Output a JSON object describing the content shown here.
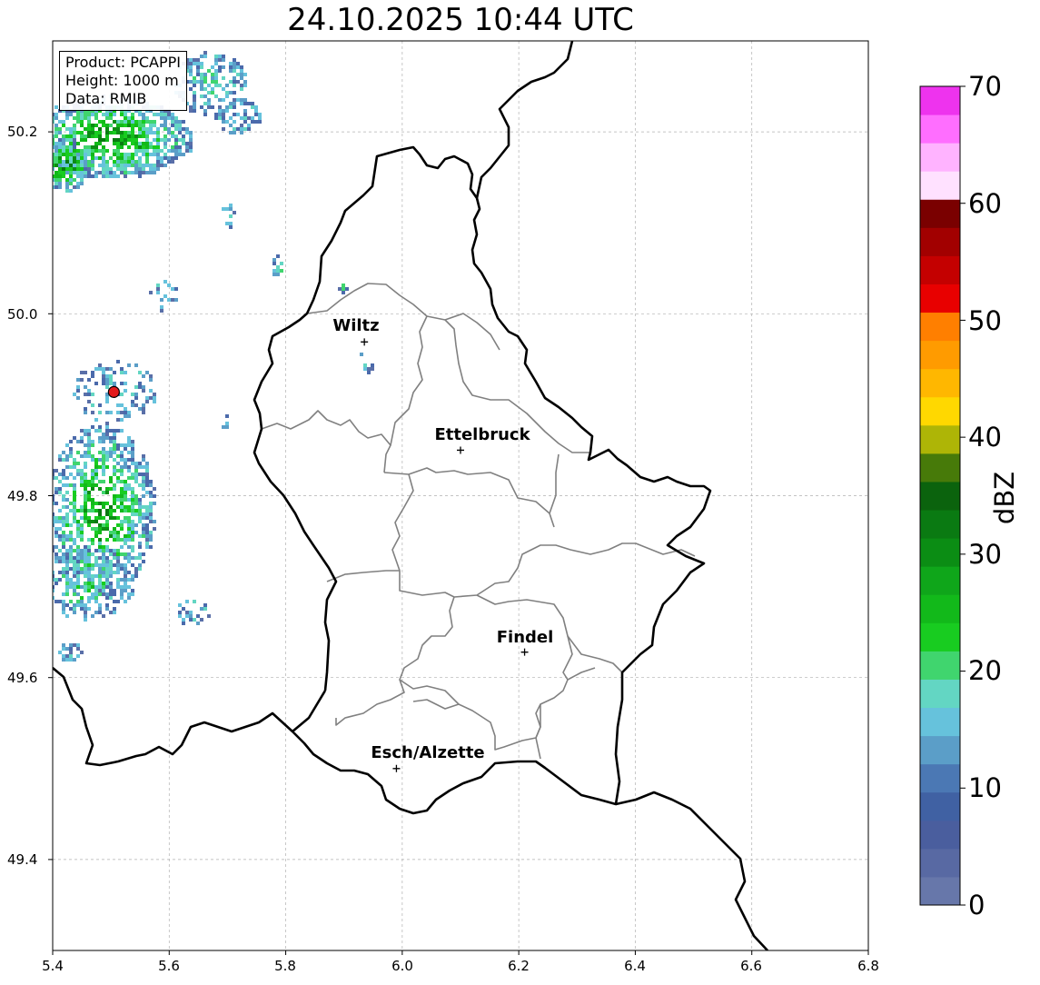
{
  "title": "24.10.2025 10:44 UTC",
  "info": {
    "product": "Product: PCAPPI",
    "height": "Height: 1000 m",
    "source": "Data: RMIB"
  },
  "axes": {
    "x_ticks": [
      "5.4",
      "5.6",
      "5.8",
      "6.0",
      "6.2",
      "6.4",
      "6.6",
      "6.8"
    ],
    "y_ticks": [
      "49.4",
      "49.6",
      "49.8",
      "50.0",
      "50.2"
    ],
    "lon_range": [
      5.4,
      6.8
    ],
    "lat_range": [
      49.3,
      50.3
    ]
  },
  "cities": [
    {
      "name": "Wiltz",
      "lon": 5.935,
      "lat": 49.969
    },
    {
      "name": "Ettelbruck",
      "lon": 6.1,
      "lat": 49.85
    },
    {
      "name": "Findel",
      "lon": 6.21,
      "lat": 49.628
    },
    {
      "name": "Esch/Alzette",
      "lon": 5.99,
      "lat": 49.5
    }
  ],
  "radar_site": {
    "lon": 5.505,
    "lat": 49.914,
    "color": "#e41a1c"
  },
  "colorbar": {
    "label": "dBZ",
    "ticks": [
      "0",
      "10",
      "20",
      "30",
      "40",
      "50",
      "60",
      "70"
    ],
    "range": [
      0,
      70
    ],
    "colors": [
      "#6777aa",
      "#5869a3",
      "#4a5e9e",
      "#4061a3",
      "#4b78b4",
      "#5b9ec8",
      "#66c2dc",
      "#63d6c3",
      "#40d56e",
      "#18cc20",
      "#12b91a",
      "#0fa61a",
      "#0b8d14",
      "#0a7a12",
      "#0b630d",
      "#477a09",
      "#aeb506",
      "#ffd800",
      "#ffb700",
      "#ff9b00",
      "#ff7f00",
      "#e80000",
      "#c40000",
      "#a20000",
      "#7a0000",
      "#ffe1ff",
      "#ffb3ff",
      "#ff6eff",
      "#ee33ee"
    ]
  },
  "colors": {
    "national_border": "#000000",
    "canton_border": "#808080",
    "grid": "#b0b0b0"
  }
}
